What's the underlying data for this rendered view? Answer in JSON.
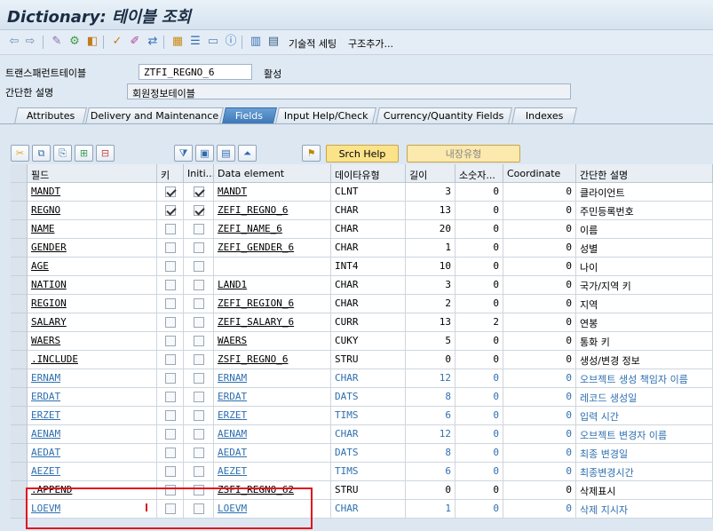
{
  "window": {
    "title": "Dictionary: 테이블 조회"
  },
  "toolbar": {
    "icons": [
      "back-icon",
      "forward-icon",
      "other-object-icon",
      "display-change-icon",
      "activate-icon",
      "check-icon",
      "object-list-icon",
      "where-used-icon",
      "navigate-icon",
      "hierarchy-icon",
      "display-object-list-icon",
      "info-icon",
      "graphic-icon",
      "menu-icon"
    ],
    "text_buttons": [
      "기술적 세팅",
      "구조추가..."
    ]
  },
  "header": {
    "table_label": "트랜스패런트테이블",
    "table_name": "ZTFI_REGNO_6",
    "status": "활성",
    "desc_label": "간단한 설명",
    "description": "회원정보테이블"
  },
  "tabs": [
    {
      "label": "Attributes",
      "active": false
    },
    {
      "label": "Delivery and Maintenance",
      "active": false
    },
    {
      "label": "Fields",
      "active": true
    },
    {
      "label": "Input Help/Check",
      "active": false
    },
    {
      "label": "Currency/Quantity Fields",
      "active": false
    },
    {
      "label": "Indexes",
      "active": false
    }
  ],
  "grid_toolbar": {
    "srch_help": "Srch Help",
    "builtin_type": "내장유형"
  },
  "columns": [
    "필드",
    "키",
    "Initi...",
    "Data element",
    "데이타유형",
    "길이",
    "소숫자...",
    "Coordinate",
    "간단한 설명"
  ],
  "rows": [
    {
      "field": "MANDT",
      "key": true,
      "init": true,
      "de": "MANDT",
      "type": "CLNT",
      "len": "3",
      "dec": "0",
      "coord": "0",
      "desc": "클라이언트",
      "style": "black"
    },
    {
      "field": "REGNO",
      "key": true,
      "init": true,
      "de": "ZEFI_REGNO_6",
      "type": "CHAR",
      "len": "13",
      "dec": "0",
      "coord": "0",
      "desc": "주민등록번호",
      "style": "black"
    },
    {
      "field": "NAME",
      "key": false,
      "init": false,
      "de": "ZEFI_NAME_6",
      "type": "CHAR",
      "len": "20",
      "dec": "0",
      "coord": "0",
      "desc": "이름",
      "style": "black"
    },
    {
      "field": "GENDER",
      "key": false,
      "init": false,
      "de": "ZEFI_GENDER_6",
      "type": "CHAR",
      "len": "1",
      "dec": "0",
      "coord": "0",
      "desc": "성별",
      "style": "black"
    },
    {
      "field": "AGE",
      "key": false,
      "init": false,
      "de": "",
      "type": "INT4",
      "len": "10",
      "dec": "0",
      "coord": "0",
      "desc": "나이",
      "style": "black"
    },
    {
      "field": "NATION",
      "key": false,
      "init": false,
      "de": "LAND1",
      "type": "CHAR",
      "len": "3",
      "dec": "0",
      "coord": "0",
      "desc": "국가/지역 키",
      "style": "black"
    },
    {
      "field": "REGION",
      "key": false,
      "init": false,
      "de": "ZEFI_REGION_6",
      "type": "CHAR",
      "len": "2",
      "dec": "0",
      "coord": "0",
      "desc": "지역",
      "style": "black"
    },
    {
      "field": "SALARY",
      "key": false,
      "init": false,
      "de": "ZEFI_SALARY_6",
      "type": "CURR",
      "len": "13",
      "dec": "2",
      "coord": "0",
      "desc": "연봉",
      "style": "black"
    },
    {
      "field": "WAERS",
      "key": false,
      "init": false,
      "de": "WAERS",
      "type": "CUKY",
      "len": "5",
      "dec": "0",
      "coord": "0",
      "desc": "통화 키",
      "style": "black"
    },
    {
      "field": ".INCLUDE",
      "key": false,
      "init": false,
      "de": "ZSFI_REGNO_6",
      "type": "STRU",
      "len": "0",
      "dec": "0",
      "coord": "0",
      "desc": "생성/변경 정보",
      "style": "black"
    },
    {
      "field": "ERNAM",
      "key": false,
      "init": false,
      "de": "ERNAM",
      "type": "CHAR",
      "len": "12",
      "dec": "0",
      "coord": "0",
      "desc": "오브젝트 생성 책임자 이름",
      "style": "blue"
    },
    {
      "field": "ERDAT",
      "key": false,
      "init": false,
      "de": "ERDAT",
      "type": "DATS",
      "len": "8",
      "dec": "0",
      "coord": "0",
      "desc": "레코드 생성일",
      "style": "blue"
    },
    {
      "field": "ERZET",
      "key": false,
      "init": false,
      "de": "ERZET",
      "type": "TIMS",
      "len": "6",
      "dec": "0",
      "coord": "0",
      "desc": "입력 시간",
      "style": "blue"
    },
    {
      "field": "AENAM",
      "key": false,
      "init": false,
      "de": "AENAM",
      "type": "CHAR",
      "len": "12",
      "dec": "0",
      "coord": "0",
      "desc": "오브젝트 변경자 이름",
      "style": "blue"
    },
    {
      "field": "AEDAT",
      "key": false,
      "init": false,
      "de": "AEDAT",
      "type": "DATS",
      "len": "8",
      "dec": "0",
      "coord": "0",
      "desc": "최종 변경일",
      "style": "blue"
    },
    {
      "field": "AEZET",
      "key": false,
      "init": false,
      "de": "AEZET",
      "type": "TIMS",
      "len": "6",
      "dec": "0",
      "coord": "0",
      "desc": "최종변경시간",
      "style": "blue"
    },
    {
      "field": ".APPEND",
      "key": false,
      "init": false,
      "de": "ZSFI_REGNO_62",
      "type": "STRU",
      "len": "0",
      "dec": "0",
      "coord": "0",
      "desc": "삭제표시",
      "style": "black"
    },
    {
      "field": "LOEVM",
      "key": false,
      "init": false,
      "de": "LOEVM",
      "type": "CHAR",
      "len": "1",
      "dec": "0",
      "coord": "0",
      "desc": "삭제 지시자",
      "style": "blue"
    }
  ],
  "colors": {
    "accent": "#3c78b8",
    "highlight": "#e0141e",
    "included_field": "#2d6fb0"
  }
}
